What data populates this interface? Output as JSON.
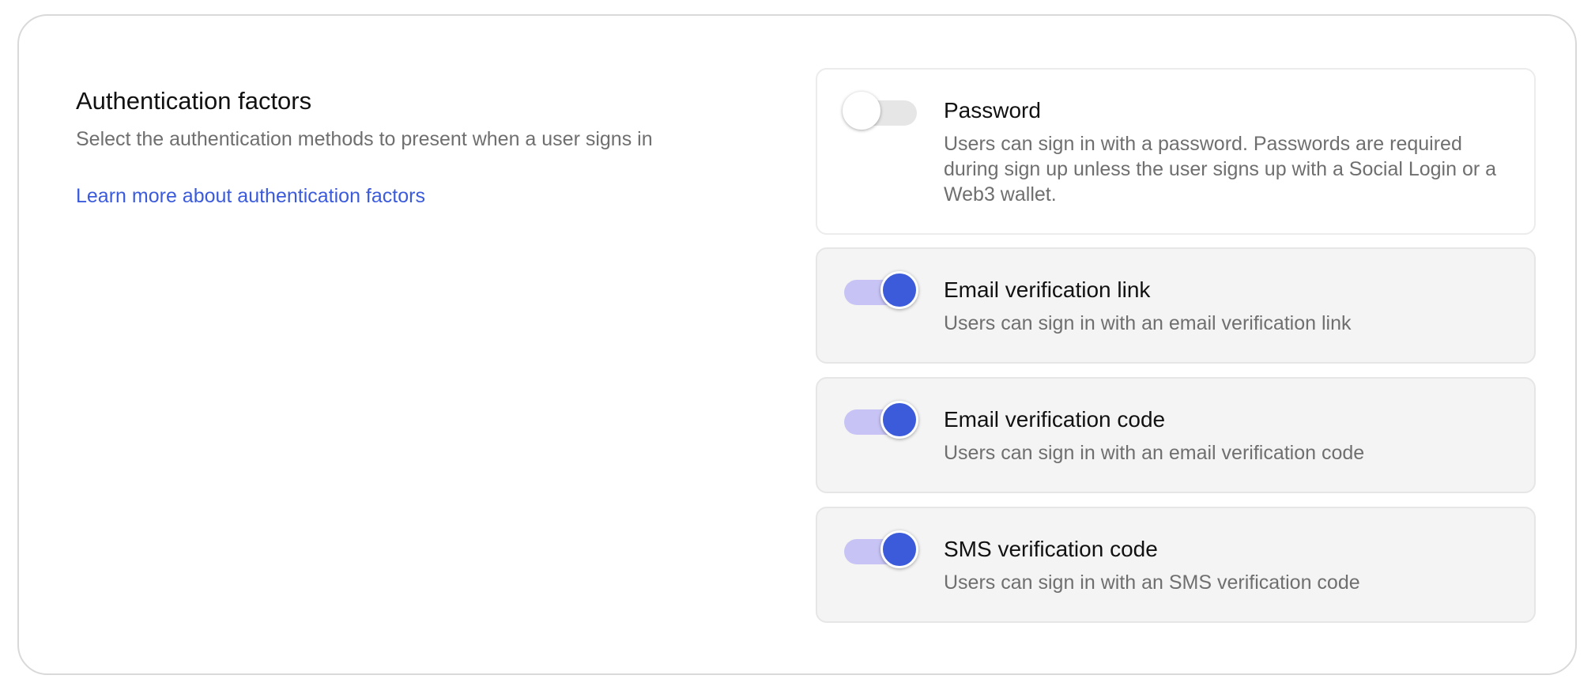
{
  "section": {
    "title": "Authentication factors",
    "subtitle": "Select the authentication methods to present when a user signs in",
    "link": "Learn more about authentication factors"
  },
  "colors": {
    "accent": "#3b5bdb",
    "toggle_track_on": "#c7c4f5",
    "toggle_track_off": "#e6e6e6"
  },
  "factors": [
    {
      "title": "Password",
      "description": "Users can sign in with a password. Passwords are required during sign up unless the user signs up with a Social Login or a Web3 wallet.",
      "enabled": false
    },
    {
      "title": "Email verification link",
      "description": "Users can sign in with an email verification link",
      "enabled": true
    },
    {
      "title": "Email verification code",
      "description": "Users can sign in with an email verification code",
      "enabled": true
    },
    {
      "title": "SMS verification code",
      "description": "Users can sign in with an SMS verification code",
      "enabled": true
    }
  ]
}
